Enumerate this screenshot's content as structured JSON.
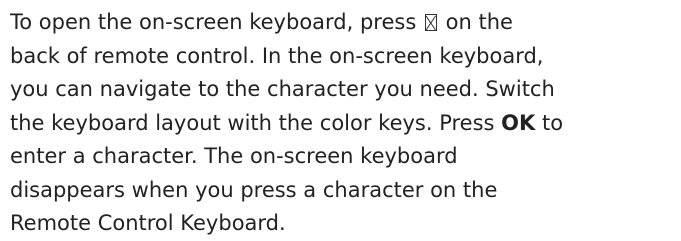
{
  "text": {
    "l1_a": "To open the on-screen keyboard, press ",
    "l1_b": " on the",
    "l2": "back of remote control. In the on-screen keyboard,",
    "l3": "you can navigate to the character you need. Switch",
    "l4_a": "the keyboard layout with the color keys. Press ",
    "ok_key": "OK",
    "l4_b": " to",
    "l5": "enter a character. The on-screen keyboard",
    "l6": "disappears when you press a character on the",
    "l7": "Remote Control Keyboard."
  },
  "icons": {
    "keyboard_key": "remote-keyboard-key-icon"
  }
}
